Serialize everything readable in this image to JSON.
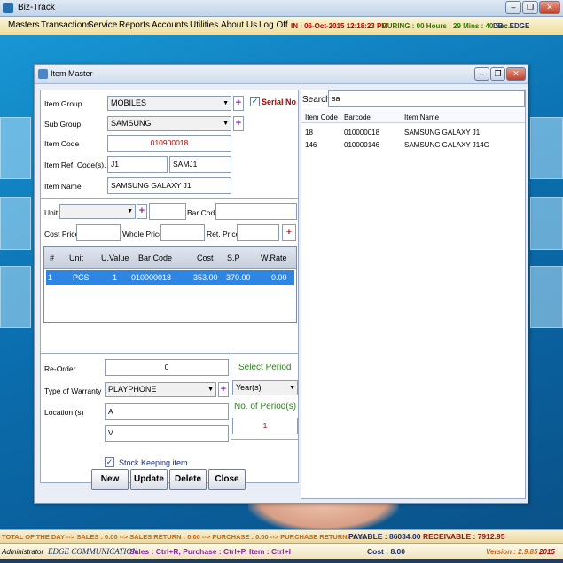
{
  "app": {
    "title": "Biz-Track"
  },
  "menu": [
    "Masters",
    "Transactions",
    "Service",
    "Reports",
    "Accounts",
    "Utilities",
    "About Us",
    "Log Off"
  ],
  "session": {
    "in_text": "IN : 06-Oct-2015 12:18:23 PM",
    "during_text": "DURING : 00 Hours : 29 Mins : 40 Sec.",
    "db_text": "DB : EDGE"
  },
  "dialog": {
    "title": "Item Master",
    "labels": {
      "item_group": "Item Group",
      "sub_group": "Sub Group",
      "item_code": "Item Code",
      "item_ref": "Item Ref. Code(s).",
      "item_name": "Item Name",
      "unit": "Unit",
      "bar_code": "Bar Code",
      "cost_price": "Cost Price",
      "whole_price": "Whole Price",
      "ret_price": "Ret. Price",
      "reorder": "Re-Order",
      "warranty": "Type of Warranty",
      "location": "Location (s)",
      "select_period": "Select Period",
      "no_period": "No. of Period(s)",
      "serial_no": "Serial No",
      "stock_keeping": "Stock Keeping item"
    },
    "values": {
      "item_group": "MOBILES",
      "sub_group": "SAMSUNG",
      "item_code": "010900018",
      "ref1": "J1",
      "ref2": "SAMJ1",
      "item_name": "SAMSUNG GALAXY J1",
      "reorder": "0",
      "warranty": "PLAYPHONE",
      "location1": "A",
      "location2": "V",
      "period": "Year(s)",
      "no_period": "1"
    },
    "grid": {
      "headers": [
        "#",
        "Unit",
        "U.Value",
        "Bar Code",
        "Cost",
        "S.P",
        "W.Rate"
      ],
      "rows": [
        [
          "1",
          "PCS",
          "1",
          "010000018",
          "353.00",
          "370.00",
          "0.00"
        ]
      ]
    },
    "buttons": {
      "new": "New",
      "update": "Update",
      "delete": "Delete",
      "close": "Close"
    }
  },
  "search": {
    "label": "Search",
    "value": "sa",
    "headers": [
      "Item Code",
      "Barcode",
      "Item Name"
    ],
    "rows": [
      [
        "18",
        "010000018",
        "SAMSUNG GALAXY J1"
      ],
      [
        "146",
        "010000146",
        "SAMSUNG GALAXY J14G"
      ]
    ]
  },
  "summary": {
    "day_text": "TOTAL OF THE DAY --> SALES : 0.00 --> SALES RETURN : 0.00 --> PURCHASE : 0.00 --> PURCHASE RETURN : 0.00",
    "payable": "PAYABLE : 86034.00",
    "receivable": "RECEIVABLE : 7912.95"
  },
  "statusbar": {
    "user": "Administrator",
    "company": "EDGE COMMUNICATION",
    "shortcuts": "Sales : Ctrl+R, Purchase : Ctrl+P, Item : Ctrl+I",
    "cost": "Cost : 8.00",
    "version": "Version : 2.9.85",
    "year": "2015"
  },
  "colors": {
    "accent_red": "#b10000",
    "accent_green": "#2d7a00",
    "selection": "#2f86e2"
  }
}
